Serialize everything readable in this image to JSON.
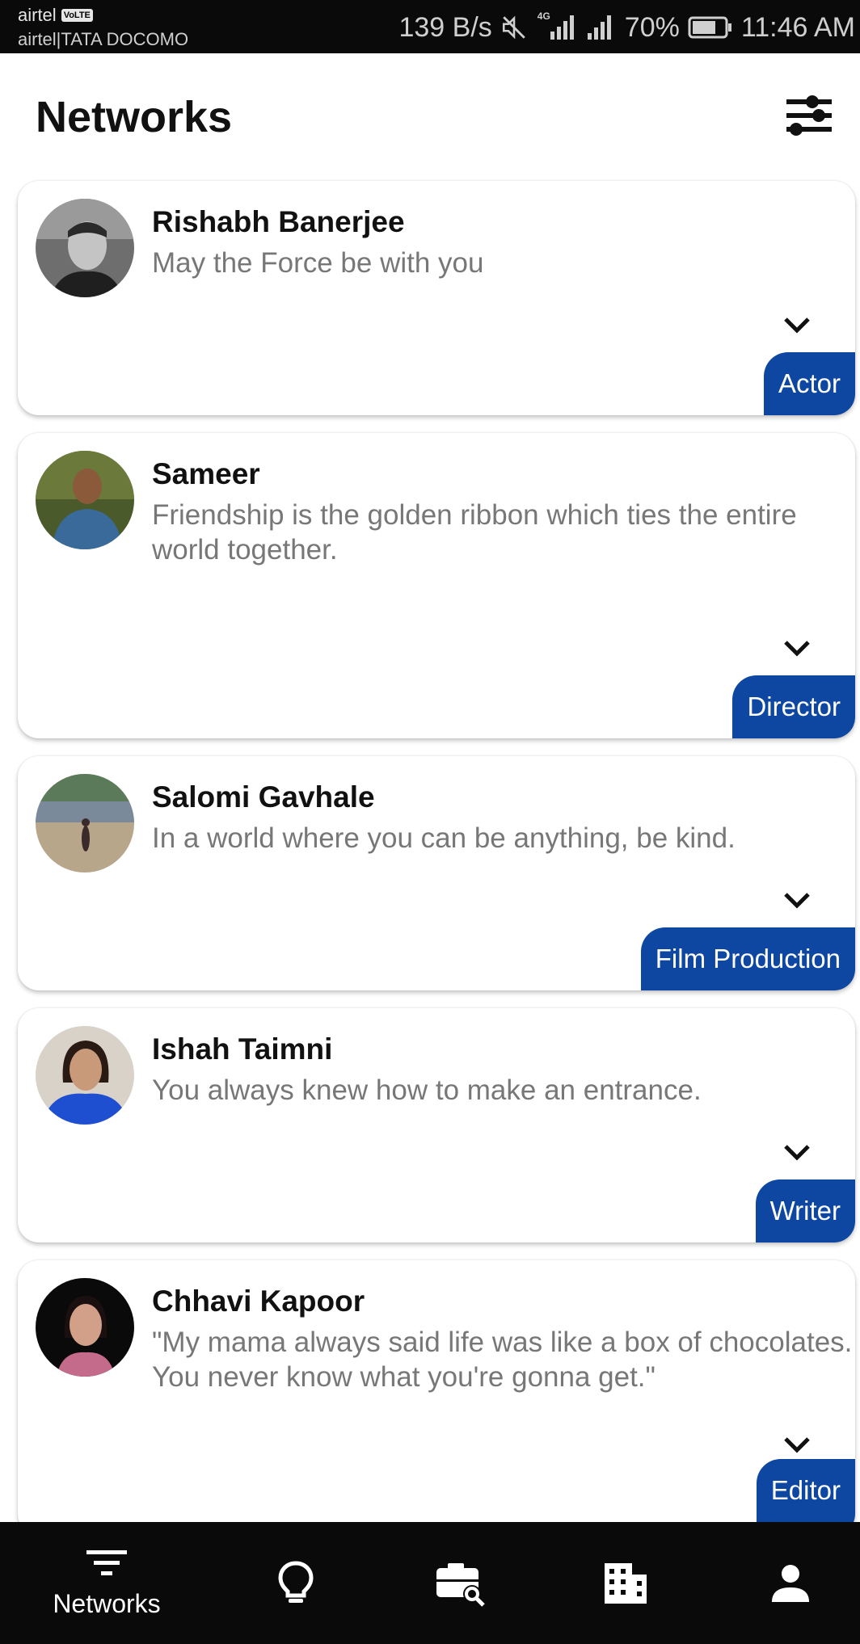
{
  "status_bar": {
    "carrier_primary": "airtel",
    "volte_badge": "VoLTE",
    "carrier_secondary": "airtel|TATA DOCOMO",
    "net_speed": "139 B/s",
    "network_type": "4G",
    "battery": "70%",
    "time": "11:46 AM",
    "icons": [
      "mute-icon",
      "signal-icon",
      "signal-icon",
      "battery-icon"
    ]
  },
  "header": {
    "title": "Networks",
    "filter_icon": "sliders-icon"
  },
  "accent_color": "#0d47a1",
  "cards": [
    {
      "name": "Rishabh Banerjee",
      "quote": "May the Force be with you",
      "role": "Actor"
    },
    {
      "name": "Sameer",
      "quote": "Friendship is the golden ribbon which ties the entire world together.",
      "role": "Director"
    },
    {
      "name": "Salomi Gavhale",
      "quote": "In a world where you can be anything, be kind.",
      "role": "Film Production"
    },
    {
      "name": "Ishah Taimni",
      "quote": "You always knew how to make an entrance.",
      "role": "Writer"
    },
    {
      "name": "Chhavi Kapoor",
      "quote": "\"My mama always said life was like a box of chocolates. You never know what you're gonna get.\"",
      "role": "Editor"
    }
  ],
  "bottom_nav": {
    "active_label": "Networks",
    "items": [
      "filter-list-icon",
      "lightbulb-icon",
      "camera-search-icon",
      "building-icon",
      "person-icon"
    ]
  }
}
